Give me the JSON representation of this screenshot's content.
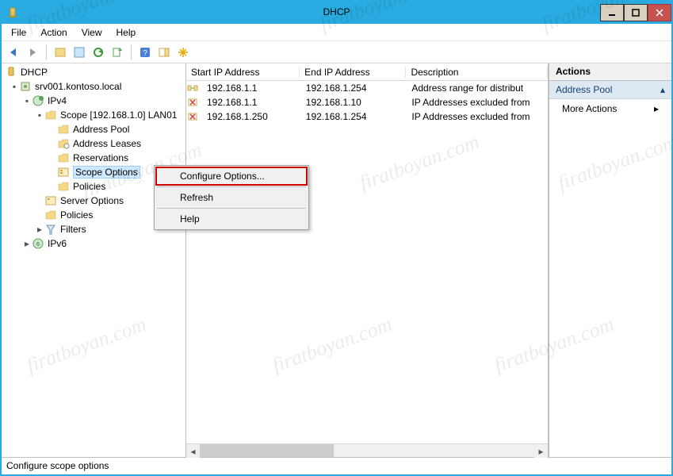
{
  "window": {
    "title": "DHCP"
  },
  "menu": {
    "file": "File",
    "action": "Action",
    "view": "View",
    "help": "Help"
  },
  "tree": {
    "root": "DHCP",
    "server": "srv001.kontoso.local",
    "ipv4": "IPv4",
    "scope": "Scope [192.168.1.0] LAN01",
    "address_pool": "Address Pool",
    "address_leases": "Address Leases",
    "reservations": "Reservations",
    "scope_options": "Scope Options",
    "scope_policies": "Policies",
    "server_options": "Server Options",
    "server_policies": "Policies",
    "filters": "Filters",
    "ipv6": "IPv6"
  },
  "list": {
    "headers": {
      "start": "Start IP Address",
      "end": "End IP Address",
      "desc": "Description"
    },
    "rows": [
      {
        "start": "192.168.1.1",
        "end": "192.168.1.254",
        "desc": "Address range for distribut"
      },
      {
        "start": "192.168.1.1",
        "end": "192.168.1.10",
        "desc": "IP Addresses excluded from"
      },
      {
        "start": "192.168.1.250",
        "end": "192.168.1.254",
        "desc": "IP Addresses excluded from"
      }
    ]
  },
  "context_menu": {
    "configure": "Configure Options...",
    "refresh": "Refresh",
    "help": "Help"
  },
  "actions": {
    "header": "Actions",
    "section": "Address Pool",
    "more": "More Actions"
  },
  "status": "Configure scope options",
  "watermark": "firatboyan.com"
}
